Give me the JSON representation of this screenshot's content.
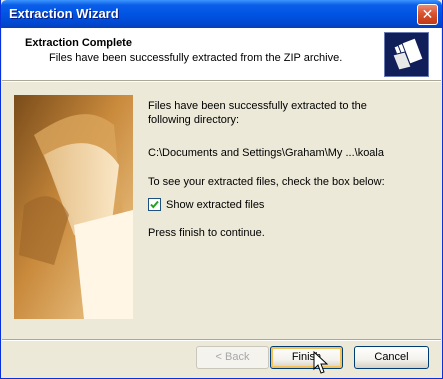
{
  "window": {
    "title": "Extraction Wizard",
    "close_glyph": "✕"
  },
  "header": {
    "title": "Extraction Complete",
    "subtitle": "Files have been successfully extracted from the ZIP archive.",
    "icon": "folders-icon"
  },
  "body": {
    "paragraph1": "Files have been successfully extracted to the following directory:",
    "path": "C:\\Documents and Settings\\Graham\\My ...\\koala",
    "paragraph2": "To see your extracted files, check the box below:",
    "checkbox": {
      "label": "Show extracted files",
      "checked": true
    },
    "paragraph3": "Press finish to continue."
  },
  "buttons": {
    "back": "< Back",
    "finish": "Finish",
    "cancel": "Cancel"
  },
  "colors": {
    "titlebar": "#0054e3",
    "header_bg": "#ffffff",
    "dialog_bg": "#ece9d8",
    "side_image": "#c98a3c"
  }
}
